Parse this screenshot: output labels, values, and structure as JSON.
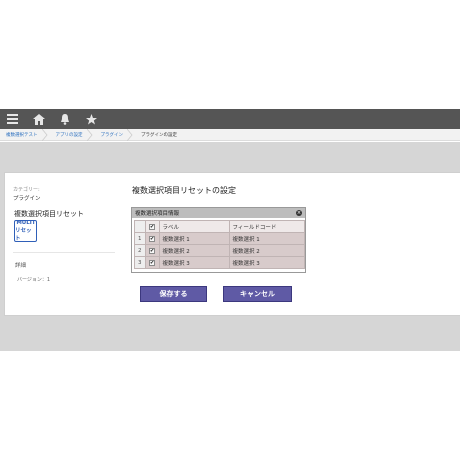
{
  "breadcrumb": [
    "複数選択テスト",
    "アプリの設定",
    "プラグイン",
    "プラグインの設定"
  ],
  "toolbar": {
    "icons": [
      "menu-icon",
      "home-icon",
      "bell-icon",
      "star-icon"
    ]
  },
  "left": {
    "category_label": "カテゴリー:",
    "category_value": "プラグイン",
    "plugin_name": "複数選択項目リセット",
    "badge_line1": "MULTI",
    "badge_line2": "リセット",
    "details": "詳細",
    "version": "バージョン：1"
  },
  "main": {
    "title": "複数選択項目リセットの設定",
    "box_title": "複数選択項目情報",
    "headers": [
      "ラベル",
      "フィールドコード"
    ],
    "rows": [
      {
        "num": "1",
        "label": "複数選択 1",
        "code": "複数選択 1"
      },
      {
        "num": "2",
        "label": "複数選択 2",
        "code": "複数選択 2"
      },
      {
        "num": "3",
        "label": "複数選択 3",
        "code": "複数選択 3"
      }
    ],
    "save_label": "保存する",
    "cancel_label": "キャンセル"
  },
  "colors": {
    "toolbar": "#555555",
    "button": "#5f5aa5",
    "link": "#2a6fbf"
  }
}
